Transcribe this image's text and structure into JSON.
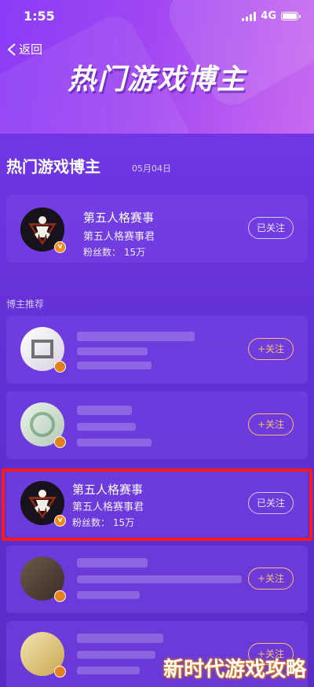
{
  "status": {
    "time": "1:55",
    "network": "4G"
  },
  "nav": {
    "back_label": "返回"
  },
  "hero": {
    "title": "热门游戏博主"
  },
  "section": {
    "title": "热门游戏博主",
    "date": "05月04日"
  },
  "featured": {
    "name": "第五人格赛事",
    "account": "第五人格赛事君",
    "fans_label": "粉丝数：",
    "fans_value": "15万",
    "button": "已关注",
    "badge": "v"
  },
  "recommend": {
    "label": "博主推荐",
    "items": [
      {
        "name": "",
        "account": "",
        "fans": "",
        "button": "+关注",
        "badge": "",
        "blurred": true
      },
      {
        "name": "",
        "account": "",
        "fans": "",
        "button": "+关注",
        "badge": "",
        "blurred": true
      },
      {
        "name": "第五人格赛事",
        "account": "第五人格赛事君",
        "fans_label": "粉丝数：",
        "fans_value": "15万",
        "button": "已关注",
        "badge": "v",
        "blurred": false
      },
      {
        "name": "",
        "account": "",
        "fans": "",
        "button": "+关注",
        "badge": "",
        "blurred": true
      },
      {
        "name": "",
        "account": "",
        "fans": "",
        "button": "+关注",
        "badge": "",
        "blurred": true
      }
    ]
  },
  "watermark": "新时代游戏攻略",
  "colors": {
    "accent_follow": "#f7c16a",
    "highlight": "#ff1a1a",
    "badge": "#f08a1c"
  }
}
